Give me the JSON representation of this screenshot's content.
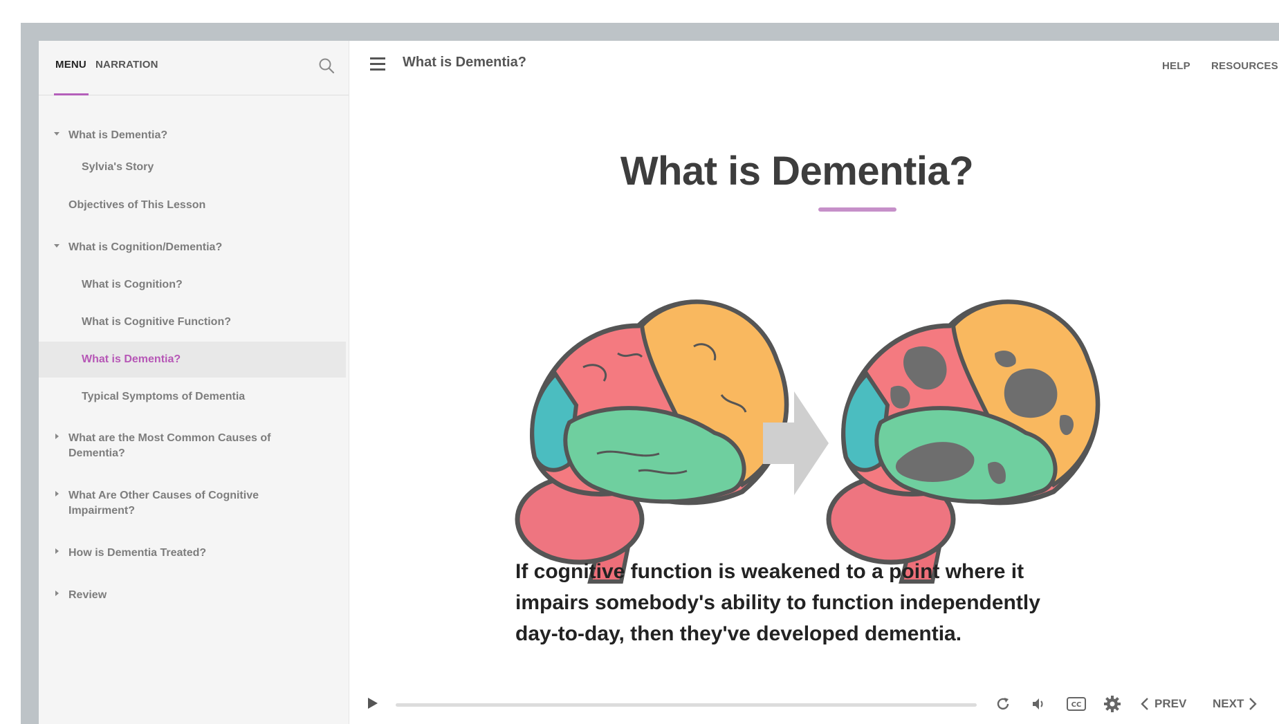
{
  "sidebar": {
    "tabs": {
      "menu": "MENU",
      "narration": "NARRATION"
    },
    "items": [
      {
        "label": "What is Dementia?",
        "level": 1,
        "caret": "expanded"
      },
      {
        "label": "Sylvia's Story",
        "level": 2
      },
      {
        "label": "Objectives of This Lesson",
        "level": 1
      },
      {
        "label": "What is Cognition/Dementia?",
        "level": 1,
        "caret": "expanded"
      },
      {
        "label": "What is Cognition?",
        "level": 2
      },
      {
        "label": "What is Cognitive Function?",
        "level": 2
      },
      {
        "label": "What is Dementia?",
        "level": 2,
        "active": true
      },
      {
        "label": "Typical Symptoms of Dementia",
        "level": 2
      },
      {
        "label_line1": "What are the Most Common Causes of",
        "label_line2": "Dementia?",
        "level": 1,
        "caret": "collapsed"
      },
      {
        "label_line1": "What Are Other Causes of Cognitive",
        "label_line2": "Impairment?",
        "level": 1,
        "caret": "collapsed"
      },
      {
        "label": "How is Dementia Treated?",
        "level": 1,
        "caret": "collapsed"
      },
      {
        "label": "Review",
        "level": 1,
        "caret": "collapsed"
      }
    ]
  },
  "header": {
    "title": "What is Dementia?",
    "help": "HELP",
    "resources": "RESOURCES"
  },
  "slide": {
    "title": "What is Dementia?",
    "caption": "If cognitive function is weakened to a point where it impairs somebody's ability to function independently day-to-day, then they've developed dementia."
  },
  "playbar": {
    "progress": 0,
    "prev": "PREV",
    "next": "NEXT",
    "cc": "CC"
  },
  "colors": {
    "accent": "#b45fba",
    "brain_frontal": "#f47a80",
    "brain_parietal": "#f9b85f",
    "brain_temporal": "#6fcf9f",
    "brain_occipital": "#4bbdc0",
    "brain_cerebellum": "#ee7580",
    "damage": "#6e6e6e"
  },
  "icons": [
    "search-icon",
    "hamburger-icon",
    "play-icon",
    "replay-icon",
    "volume-icon",
    "closed-captions-icon",
    "gear-icon",
    "chevron-left-icon",
    "chevron-right-icon",
    "arrow-right-icon"
  ]
}
